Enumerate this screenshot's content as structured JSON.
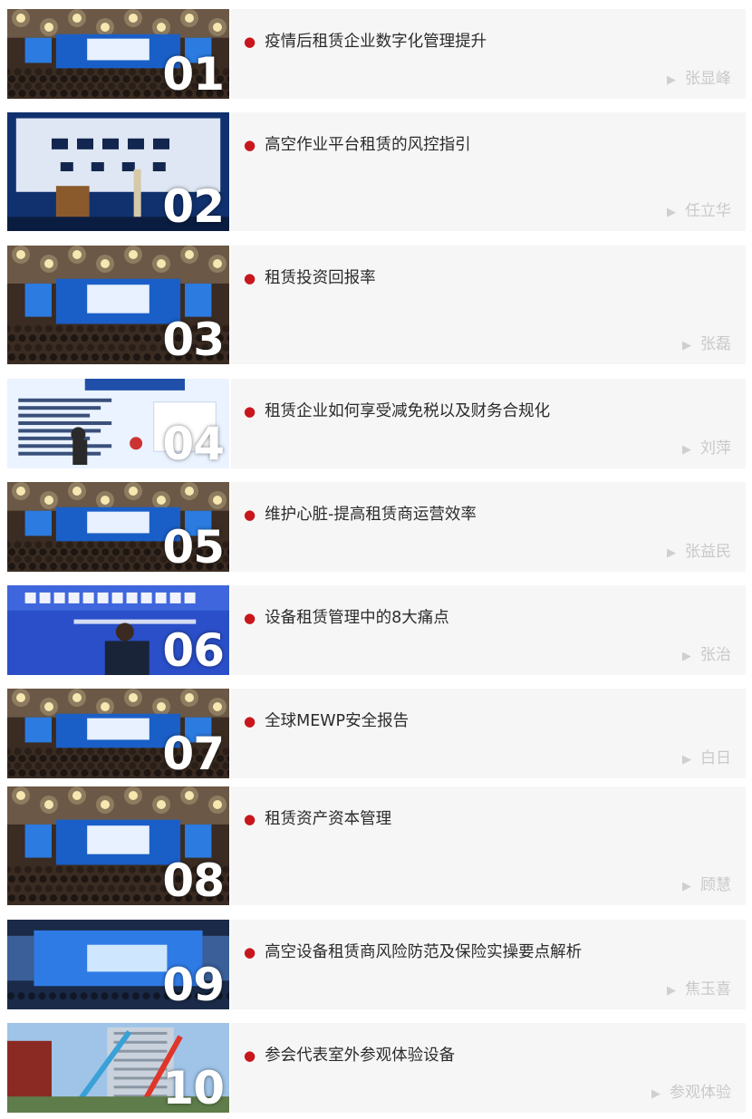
{
  "items": [
    {
      "number": "01",
      "title": "疫情后租赁企业数字化管理提升",
      "speaker": "张显峰",
      "photo_scene": "hall-chandeliers"
    },
    {
      "number": "02",
      "title": "高空作业平台租赁的风控指引",
      "speaker": "任立华",
      "photo_scene": "stage-speaker"
    },
    {
      "number": "03",
      "title": "租赁投资回报率",
      "speaker": "张磊",
      "photo_scene": "hall-chandeliers"
    },
    {
      "number": "04",
      "title": "租赁企业如何享受减免税以及财务合规化",
      "speaker": "刘萍",
      "photo_scene": "slide-text"
    },
    {
      "number": "05",
      "title": "维护心脏-提高租赁商运营效率",
      "speaker": "张益民",
      "photo_scene": "hall-chandeliers"
    },
    {
      "number": "06",
      "title": "设备租赁管理中的8大痛点",
      "speaker": "张治",
      "photo_scene": "slide-speaker"
    },
    {
      "number": "07",
      "title": "全球MEWP安全报告",
      "speaker": "白日",
      "photo_scene": "hall-chandeliers"
    },
    {
      "number": "08",
      "title": "租赁资产资本管理",
      "speaker": "顾慧",
      "photo_scene": "hall-chandeliers"
    },
    {
      "number": "09",
      "title": "高空设备租赁商风险防范及保险实操要点解析",
      "speaker": "焦玉喜",
      "photo_scene": "screen-wide"
    },
    {
      "number": "10",
      "title": "参会代表室外参观体验设备",
      "speaker": "参观体验",
      "photo_scene": "outdoor-lifts"
    }
  ],
  "colors": {
    "bullet": "#c8161d",
    "card": "#f6f6f6",
    "speaker": "#c9c9c9",
    "title": "#2b2b2b"
  },
  "icons": {
    "bullet": "red-dot-icon",
    "speaker_marker": "play-triangle-icon"
  }
}
